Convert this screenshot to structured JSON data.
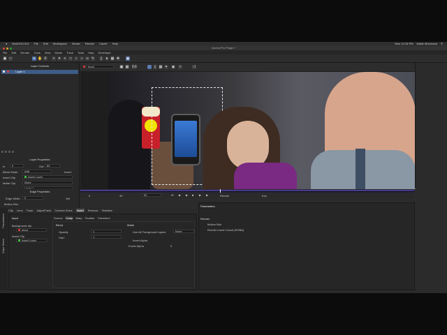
{
  "menubar": {
    "apple": "",
    "app": "NukeX10.0v3",
    "items": [
      "File",
      "Edit",
      "Workspace",
      "Viewer",
      "Render",
      "Cache",
      "Help"
    ],
    "clock": "Mon 12:18 PM",
    "user": "Martin Brennand"
  },
  "window": {
    "title": "mocha Pro Plugin *"
  },
  "appmenu": {
    "items": [
      "File",
      "Edit",
      "Render",
      "Tools",
      "View",
      "Movie",
      "Track",
      "Tools",
      "Help",
      "Developer"
    ]
  },
  "left_panel": {
    "layer_controls_title": "Layer Controls",
    "layer_row": "Layer 1",
    "layer_properties_title": "Layer Properties",
    "in_label": "In",
    "in_value": "0",
    "out_label": "Out",
    "out_value": "89",
    "blend_mode_label": "Blend Mode",
    "blend_mode_value": "Add",
    "invert_label": "Invert",
    "insert_clip_label": "Insert Clip",
    "insert_clip_value": "Insert Layer",
    "matte_clip_label": "Matte Clip",
    "matte_clip_value": "None",
    "link_to_track_label": "Link to track",
    "link_to_track_value": "Layer 1",
    "edge_properties_title": "Edge Properties",
    "edge_width_label": "Edge Width",
    "edge_width_value": "0",
    "set_button": "Set",
    "motion_blur_label": "Motion Blur"
  },
  "viewer": {
    "clip_value": "Input",
    "frame_start": "0",
    "frame_current": "40",
    "frame_field": "90",
    "render_label": "Render",
    "key_label": "Key",
    "zoom": "0.6"
  },
  "bottom": {
    "tabs": [
      "Clip",
      "Lens",
      "Track",
      "AdjustTrack",
      "Camera Solve",
      "Insert",
      "Remove",
      "Stabilize"
    ],
    "selected_tab": "Insert",
    "side_tabs": [
      "Parameters",
      "Dope Sheet"
    ],
    "input_title": "Input",
    "background_clip_label": "Background clip",
    "background_clip_value": "Input",
    "insert_clip_label": "Insert Clip",
    "insert_clip_value": "Insert Layer",
    "subtabs": [
      "Source",
      "Comp",
      "Warp",
      "Feather",
      "Transform"
    ],
    "blend_title": "Blend",
    "opacity_label": "Opacity",
    "opacity_value": "1",
    "gain_label": "Gain",
    "gain_value": "1",
    "matte_title": "Matte",
    "use_all_fg_label": "Use All Foreground Layers",
    "use_all_fg_value": "None",
    "invert_alpha_label": "Invert Alpha",
    "erode_alpha_label": "Erode Alpha",
    "erode_alpha_value": "0"
  },
  "params": {
    "title": "Parameters",
    "render_title": "Render",
    "motion_blur_label": "Motion Blur",
    "render_cutout_label": "Render Insert Cutout (RGBA)"
  },
  "colors": {
    "accent": "#4f6fa8",
    "timeline": "#6b55d1",
    "layer_red": "#d23a3a",
    "layer_green": "#3fbf3f"
  }
}
